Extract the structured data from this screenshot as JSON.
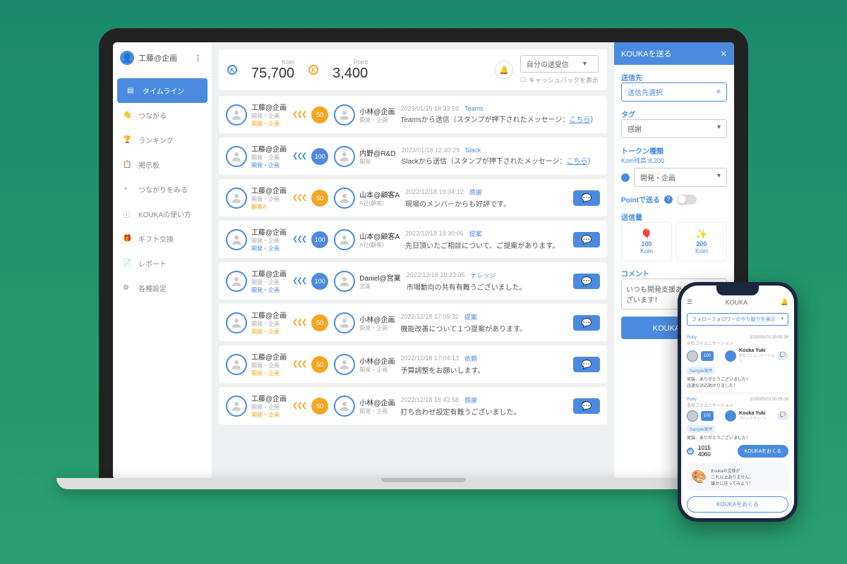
{
  "user": {
    "name": "工藤@企画"
  },
  "sidebar": {
    "items": [
      {
        "label": "タイムライン",
        "icon": "timeline"
      },
      {
        "label": "つながる",
        "icon": "connect"
      },
      {
        "label": "ランキング",
        "icon": "ranking"
      },
      {
        "label": "掲示板",
        "icon": "board"
      },
      {
        "label": "つながりをみる",
        "icon": "network"
      },
      {
        "label": "KOUKAの使い方",
        "icon": "help"
      },
      {
        "label": "ギフト交換",
        "icon": "gift"
      },
      {
        "label": "レポート",
        "icon": "report"
      },
      {
        "label": "各種設定",
        "icon": "settings"
      }
    ]
  },
  "stats": {
    "koin_label": "Koin",
    "koin": "75,700",
    "point_label": "Point",
    "point": "3,400"
  },
  "filter": {
    "value": "自分の送受信",
    "cashback": "キャッシュバックを表示"
  },
  "rows": [
    {
      "from": "工藤@企画",
      "from_sub": "開発・企画",
      "dept": "開発・企画",
      "amt": "50",
      "amt_color": "orange",
      "to": "小林@企画",
      "to_sub": "開発・企画",
      "date": "2023/01/19 19:33:59",
      "tag": "Teams",
      "msg": "Teamsから送信（スタンプが押下されたメッセージ：",
      "link": "こちら",
      "chat": false
    },
    {
      "from": "工藤@企画",
      "from_sub": "開発・企画",
      "dept": "開発・企画",
      "dept_color": "blue",
      "amt": "100",
      "amt_color": "blue",
      "to": "内野@R&D",
      "to_sub": "開発",
      "date": "2023/01/18 12:40:29",
      "tag": "Slack",
      "msg": "Slackから送信（スタンプが押下されたメッセージ：",
      "link": "こちら",
      "chat": false
    },
    {
      "from": "工藤@企画",
      "from_sub": "開発・企画",
      "dept": "顧客A",
      "amt": "50",
      "amt_color": "orange",
      "to": "山本@顧客A",
      "to_sub": "A社(顧客)",
      "date": "2022/12/18 19:34:12",
      "tag": "感謝",
      "msg": "現場のメンバーからも好評です。",
      "chat": true
    },
    {
      "from": "工藤@企画",
      "from_sub": "開発・企画",
      "dept": "開発・企画",
      "dept_color": "blue",
      "amt": "100",
      "amt_color": "blue",
      "to": "山本@顧客A",
      "to_sub": "A社(顧客)",
      "date": "2022/12/18 19:30:05",
      "tag": "提案",
      "msg": "先日頂いたご相談について、ご提案があります。",
      "chat": true
    },
    {
      "from": "工藤@企画",
      "from_sub": "開発・企画",
      "dept": "開発・企画",
      "dept_color": "blue",
      "amt": "100",
      "amt_color": "blue",
      "to": "Daniel@営業",
      "to_sub": "営業",
      "date": "2022/12/18 19:23:05",
      "tag": "ナレッジ",
      "msg": "市場動向の共有有難うございました。",
      "chat": true
    },
    {
      "from": "工藤@企画",
      "from_sub": "開発・企画",
      "dept": "開発・企画",
      "amt": "50",
      "amt_color": "orange",
      "to": "小林@企画",
      "to_sub": "開発・企画",
      "date": "2022/12/18 17:05:32",
      "tag": "提案",
      "msg": "機能改善について１つ提案があります。",
      "chat": true
    },
    {
      "from": "工藤@企画",
      "from_sub": "開発・企画",
      "dept": "開発・企画",
      "amt": "50",
      "amt_color": "orange",
      "to": "小林@企画",
      "to_sub": "開発・企画",
      "date": "2022/12/18 17:04:13",
      "tag": "依頼",
      "msg": "予算調整をお願いします。",
      "chat": true
    },
    {
      "from": "工藤@企画",
      "from_sub": "開発・企画",
      "dept": "開発・企画",
      "amt": "50",
      "amt_color": "orange",
      "to": "小林@企画",
      "to_sub": "開発・企画",
      "date": "2022/12/18 16:43:58",
      "tag": "感謝",
      "msg": "打ち合わせ設定有難うございました。",
      "chat": true
    }
  ],
  "panel": {
    "title": "KOUKAを送る",
    "dest_label": "送信先",
    "dest_button": "送信先選択",
    "tag_label": "タグ",
    "tag_value": "感謝",
    "token_label": "トークン種類",
    "balance_label": "Koin残高:",
    "balance": "8,200",
    "token_value": "開発・企画",
    "point_label": "Pointで送る",
    "amount_label": "送信量",
    "amounts": [
      {
        "n": "100",
        "u": "Koin"
      },
      {
        "n": "200",
        "u": "Koin"
      }
    ],
    "comment_label": "コメント",
    "comment_value": "いつも開発支援ありがとうございます！",
    "send": "KOUKA送信"
  },
  "phone": {
    "title": "KOUKA",
    "filter": "フォローフォロワーのやり取りを表示",
    "cards": [
      {
        "from": "Ruby",
        "from_sub": "全社コミュニケーション",
        "to": "Kouka Yuki",
        "to_sub": "全社コミュニケーション",
        "date": "2020/05/03 20:05:36",
        "amt": "100",
        "tag": "Sample案件",
        "msg": "実装、ありがとうございました！\n迅速な対応助かりました！"
      },
      {
        "from": "Ruby",
        "from_sub": "全社コミュニケーション",
        "to": "Kouka Yuki",
        "to_sub": "ブロックチェーン",
        "date": "2020/05/03 20:05:09",
        "amt": "100",
        "tag": "Sample案件",
        "msg": "実装、ありがとうございました！"
      }
    ],
    "stat1": "1015",
    "stat2": "4060",
    "send": "KOUKAをおくる",
    "promo": "Koukaの交換が\nこれ以上ありません。\n誰かに送ってみよう！",
    "cta": "KOUKAをおくる"
  }
}
